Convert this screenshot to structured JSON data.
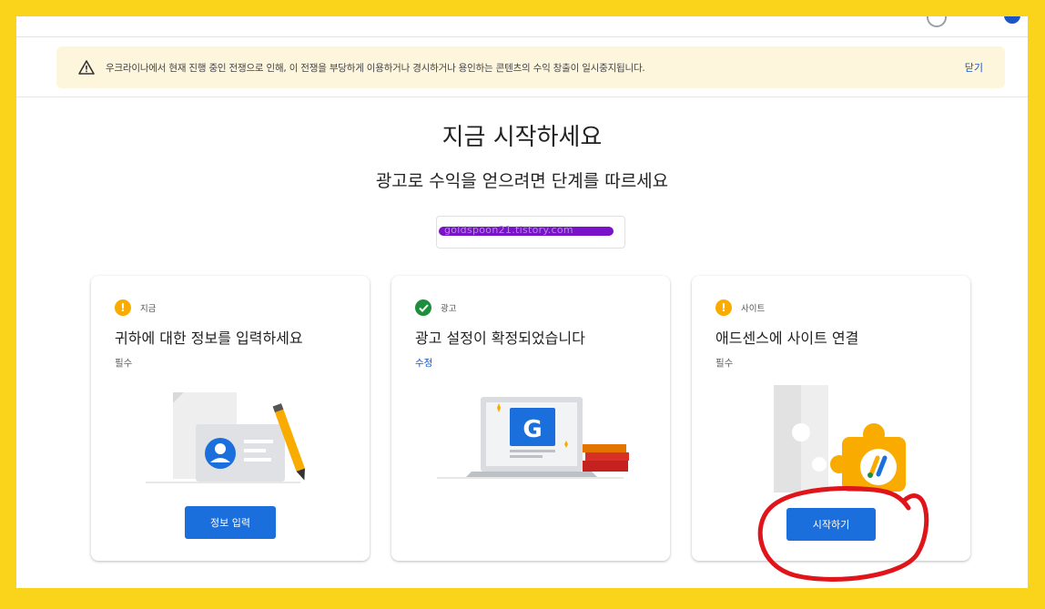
{
  "banner": {
    "message": "우크라이나에서 현재 진행 중인 전쟁으로 인해, 이 전쟁을 부당하게 이용하거나 경시하거나 용인하는 콘텐츠의 수익 창출이 일시중지됩니다.",
    "close_label": "닫기"
  },
  "heading": {
    "title": "지금 시작하세요",
    "subtitle": "광고로 수익을 얻으려면 단계를 따르세요"
  },
  "site": {
    "url": "goldspoon21.tistory.com"
  },
  "cards": [
    {
      "status_icon": "warning-icon",
      "status_color": "#f9ab00",
      "tag": "지금",
      "title": "귀하에 대한 정보를 입력하세요",
      "sub": "필수",
      "button": "정보 입력"
    },
    {
      "status_icon": "check-icon",
      "status_color": "#1e8e3e",
      "tag": "광고",
      "title": "광고 설정이 확정되었습니다",
      "sub": "수정"
    },
    {
      "status_icon": "warning-icon",
      "status_color": "#f9ab00",
      "tag": "사이트",
      "title": "애드센스에 사이트 연결",
      "sub": "필수",
      "button": "시작하기"
    }
  ],
  "colors": {
    "accent": "#1a6fdc",
    "frame": "#f9d41a",
    "annotation": "#e0141b",
    "illustration_g": "#4285f4"
  }
}
